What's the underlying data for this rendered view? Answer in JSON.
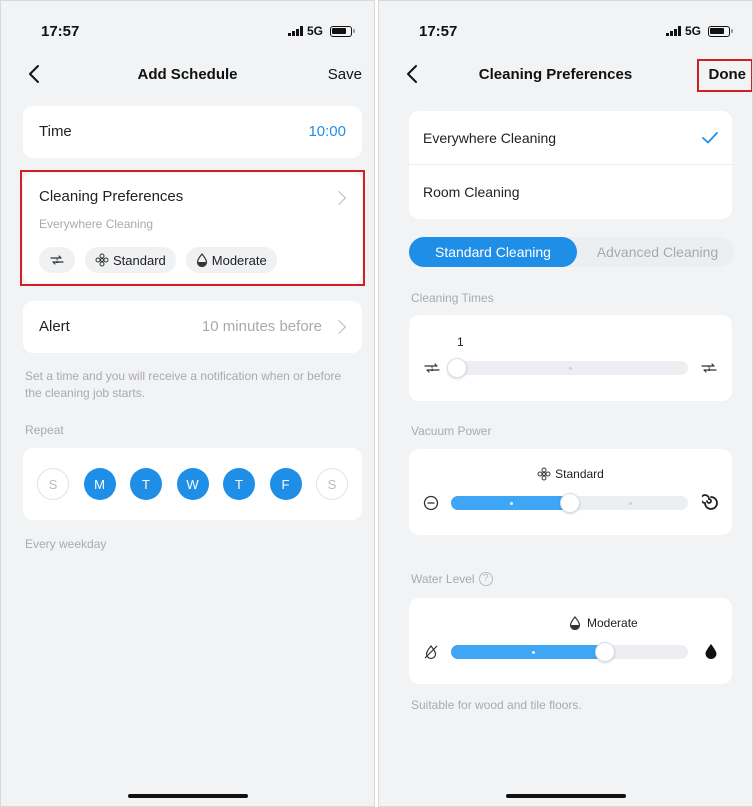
{
  "left": {
    "status": {
      "time": "17:57",
      "network": "5G"
    },
    "nav": {
      "title": "Add Schedule",
      "action": "Save"
    },
    "time_row": {
      "label": "Time",
      "value": "10:00"
    },
    "prefs": {
      "title": "Cleaning Preferences",
      "subtitle": "Everywhere Cleaning",
      "chips": {
        "power": "Standard",
        "water": "Moderate"
      }
    },
    "alert": {
      "label": "Alert",
      "value": "10 minutes before"
    },
    "hint": "Set a time and you will receive a notification when or before the cleaning job starts.",
    "repeat": {
      "label": "Repeat",
      "days": [
        {
          "letter": "S",
          "selected": false
        },
        {
          "letter": "M",
          "selected": true
        },
        {
          "letter": "T",
          "selected": true
        },
        {
          "letter": "W",
          "selected": true
        },
        {
          "letter": "T",
          "selected": true
        },
        {
          "letter": "F",
          "selected": true
        },
        {
          "letter": "S",
          "selected": false
        }
      ],
      "summary": "Every weekday"
    }
  },
  "right": {
    "status": {
      "time": "17:57",
      "network": "5G"
    },
    "nav": {
      "title": "Cleaning Preferences",
      "action": "Done"
    },
    "modes": {
      "everywhere": "Everywhere Cleaning",
      "room": "Room Cleaning"
    },
    "tabs": {
      "standard": "Standard Cleaning",
      "advanced": "Advanced Cleaning"
    },
    "cleaning_times": {
      "label": "Cleaning Times",
      "value": "1"
    },
    "vacuum": {
      "label": "Vacuum Power",
      "value": "Standard",
      "level": 0.5
    },
    "water": {
      "label": "Water Level",
      "value": "Moderate",
      "level": 0.65
    },
    "footer": "Suitable for wood and tile floors."
  },
  "colors": {
    "accent": "#1f8ee6",
    "highlight": "#d11f26"
  }
}
